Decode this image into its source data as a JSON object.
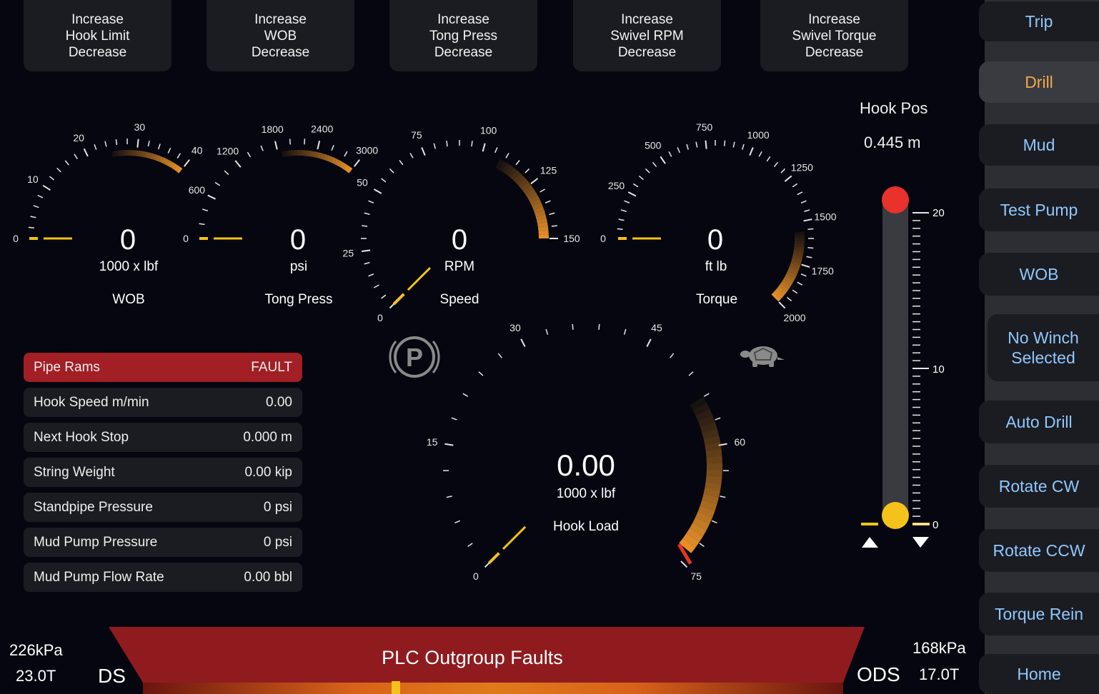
{
  "top_buttons": [
    {
      "line1": "Increase",
      "line2": "Hook Limit",
      "line3": "Decrease"
    },
    {
      "line1": "Increase",
      "line2": "WOB",
      "line3": "Decrease"
    },
    {
      "line1": "Increase",
      "line2": "Tong Press",
      "line3": "Decrease"
    },
    {
      "line1": "Increase",
      "line2": "Swivel RPM",
      "line3": "Decrease"
    },
    {
      "line1": "Increase",
      "line2": "Swivel Torque",
      "line3": "Decrease"
    }
  ],
  "sidebar": {
    "items": [
      "Trip",
      "Drill",
      "Mud",
      "Test Pump",
      "WOB",
      "No Winch Selected",
      "Auto Drill",
      "Rotate CW",
      "Rotate CCW",
      "Torque Rein",
      "Home"
    ],
    "active": "Drill",
    "accent_color": "#8fc8ff",
    "active_color": "#f4a64a"
  },
  "gauges": {
    "wob": {
      "value": "0",
      "unit": "1000 x lbf",
      "label": "WOB",
      "ticks": [
        "0",
        "10",
        "20",
        "30",
        "40"
      ]
    },
    "tong": {
      "value": "0",
      "unit": "psi",
      "label": "Tong Press",
      "ticks": [
        "0",
        "600",
        "1200",
        "1800",
        "2400",
        "3000"
      ]
    },
    "speed": {
      "value": "0",
      "unit": "RPM",
      "label": "Speed",
      "ticks": [
        "0",
        "25",
        "50",
        "75",
        "100",
        "125",
        "150"
      ]
    },
    "torque": {
      "value": "0",
      "unit": "ft lb",
      "label": "Torque",
      "ticks": [
        "0",
        "250",
        "500",
        "750",
        "1000",
        "1250",
        "1500",
        "1750",
        "2000"
      ]
    },
    "hookload": {
      "value": "0.00",
      "unit": "1000 x lbf",
      "label": "Hook Load",
      "ticks": [
        "0",
        "15",
        "30",
        "45",
        "60",
        "75"
      ]
    }
  },
  "status_panel": [
    {
      "label": "Pipe Rams",
      "value": "FAULT",
      "state": "fault"
    },
    {
      "label": "Hook Speed m/min",
      "value": "0.00"
    },
    {
      "label": "Next Hook Stop",
      "value": "0.000 m"
    },
    {
      "label": "String Weight",
      "value": "0.00 kip"
    },
    {
      "label": "Standpipe Pressure",
      "value": "0 psi"
    },
    {
      "label": "Mud Pump Pressure",
      "value": "0 psi"
    },
    {
      "label": "Mud Pump Flow Rate",
      "value": "0.00 bbl"
    }
  ],
  "hook_pos": {
    "title": "Hook Pos",
    "value": "0.445 m",
    "scale": [
      "20",
      "10",
      "0"
    ]
  },
  "icons": {
    "parking": "parking-brake-icon",
    "turtle": "turtle-icon"
  },
  "bottom": {
    "left_pressure": "226kPa",
    "left_weight": "23.0T",
    "left_label": "DS",
    "alarm": "PLC Outgroup Faults",
    "right_pressure": "168kPa",
    "right_weight": "17.0T",
    "right_label": "ODS",
    "alarm_color": "#8f1b1f"
  }
}
